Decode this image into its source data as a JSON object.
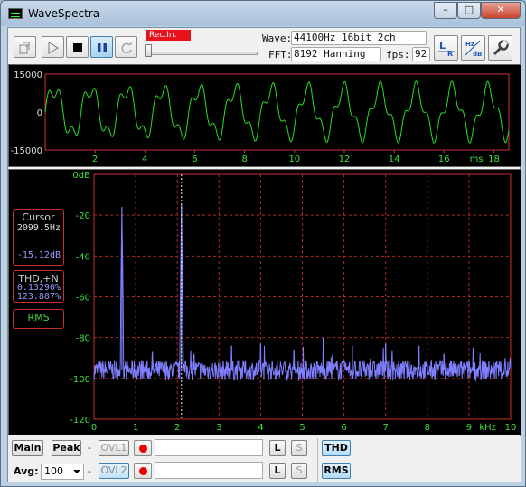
{
  "window": {
    "title": "WaveSpectra",
    "min": "–",
    "max": "□",
    "close": "✕"
  },
  "toolbar": {
    "rec_label": "Rec.In.",
    "wave_label": "Wave:",
    "wave_value": "44100Hz 16bit 2ch",
    "fft_label": "FFT:",
    "fft_value": "8192 Hanning",
    "fps_label": "fps:",
    "fps_value": "92",
    "icons": [
      "open-file-icon",
      "play-icon",
      "stop-icon",
      "pause-icon",
      "reload-icon",
      "lr-channel-icon",
      "hz-db-scale-icon",
      "settings-wrench-icon"
    ]
  },
  "waveform": {
    "y_ticks": [
      "15000",
      "0",
      "-15000"
    ],
    "x_ticks": [
      "2",
      "4",
      "6",
      "8",
      "10",
      "12",
      "14",
      "16",
      "18"
    ],
    "x_unit": "ms",
    "trace_color": "#22e022",
    "axis_color": "#d03030"
  },
  "spectrum": {
    "y_ticks": [
      "0dB",
      "-20",
      "-40",
      "-60",
      "-80",
      "-100",
      "-120"
    ],
    "x_ticks": [
      "1",
      "2",
      "3",
      "4",
      "5",
      "6",
      "7",
      "8",
      "9",
      "10"
    ],
    "x_first": "0",
    "x_unit": "kHz",
    "trace_color": "#7f7fff",
    "cursor": {
      "title": "Cursor",
      "freq": "2099.5Hz",
      "level": "-15.12dB",
      "freq_khz": 2.0995
    },
    "thd": {
      "title": "THD,+N",
      "val1": "0.13290%",
      "val2": "123.887%"
    },
    "rms": {
      "title": "RMS"
    }
  },
  "bottom": {
    "main": "Main",
    "peak": "Peak",
    "dash": "-",
    "ovl1": "OVL1",
    "ovl2": "OVL2",
    "l": "L",
    "s": "S",
    "thd": "THD",
    "rms": "RMS",
    "avg_label": "Avg:",
    "avg_value": "100"
  },
  "chart_data": [
    {
      "type": "line",
      "yticks": [
        15000,
        0,
        -15000
      ],
      "xticks": [
        2,
        4,
        6,
        8,
        10,
        12,
        14,
        16,
        18
      ],
      "xlabel": "ms",
      "xlim": [
        0,
        18.6
      ],
      "ylim": [
        -15000,
        15000
      ],
      "series": [
        {
          "values": [
            {
              "freq_hz": 689,
              "amp": 9000
            },
            {
              "freq_hz": 2099.5,
              "amp": 3200
            }
          ]
        }
      ]
    },
    {
      "type": "line",
      "yticks": [
        "0dB",
        -20,
        -40,
        -60,
        -80,
        -100,
        -120
      ],
      "xticks": [
        1,
        2,
        3,
        4,
        5,
        6,
        7,
        8,
        9,
        10
      ],
      "xlabel": "kHz",
      "xlim": [
        0,
        10
      ],
      "ylim": [
        -120,
        0
      ],
      "noise_floor_db": -96,
      "series": [
        {
          "points": [
            {
              "x": 0.67,
              "y": -16
            },
            {
              "x": 1.4,
              "y": -87
            },
            {
              "x": 2.1,
              "y": -15
            },
            {
              "x": 2.4,
              "y": -88
            },
            {
              "x": 3.3,
              "y": -84
            },
            {
              "x": 4.0,
              "y": -83
            },
            {
              "x": 4.8,
              "y": -86
            },
            {
              "x": 5.5,
              "y": -80
            },
            {
              "x": 6.2,
              "y": -84
            },
            {
              "x": 7.0,
              "y": -83
            },
            {
              "x": 7.8,
              "y": -84
            },
            {
              "x": 8.4,
              "y": -88
            },
            {
              "x": 9.1,
              "y": -85
            }
          ]
        }
      ]
    }
  ]
}
